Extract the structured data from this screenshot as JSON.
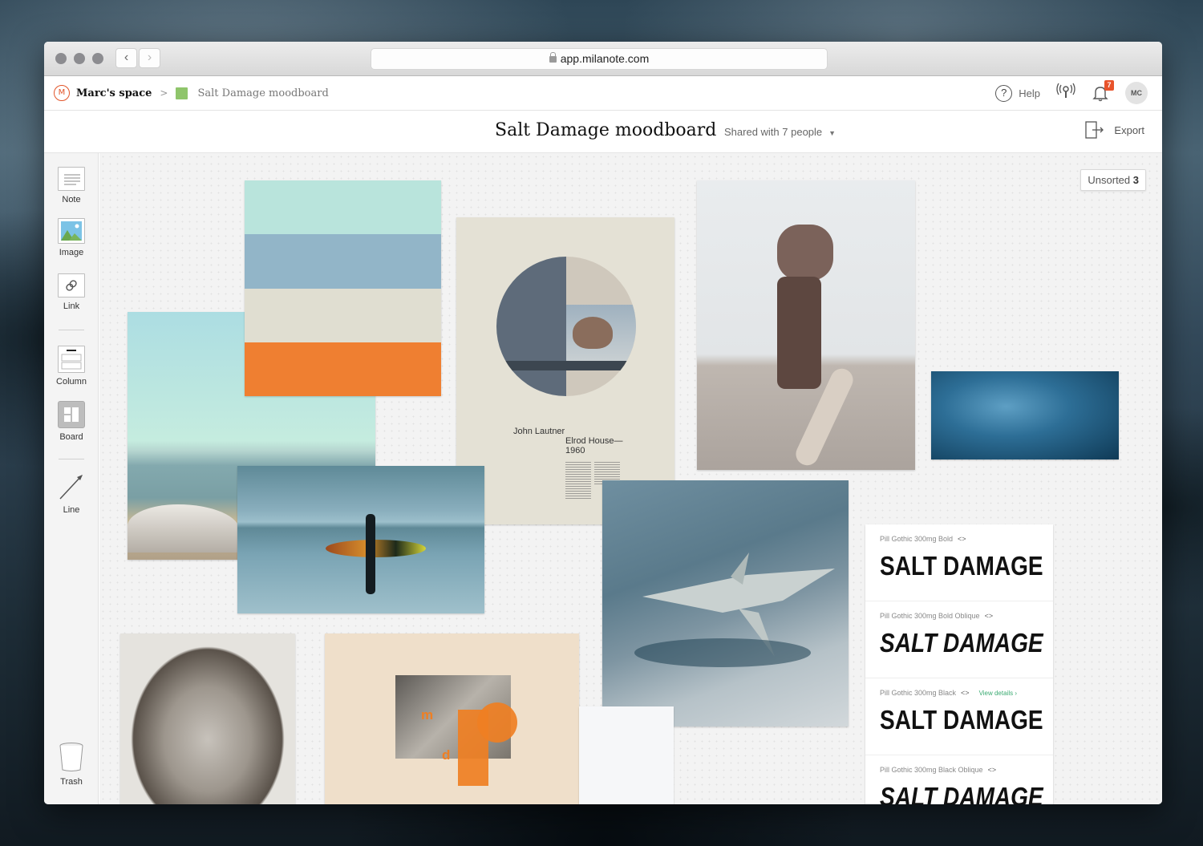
{
  "browser": {
    "url": "app.milanote.com",
    "back_icon": "chevron-left-icon",
    "forward_icon": "chevron-right-icon"
  },
  "header": {
    "logo_initials": "M",
    "breadcrumb": {
      "space": "Marc's space",
      "separator": ">",
      "board": "Salt Damage moodboard",
      "board_color": "#8fc56b"
    },
    "help_label": "Help",
    "notifications_count": "7",
    "avatar_initials": "MC",
    "accent_color": "#e8532b"
  },
  "titlebar": {
    "title": "Salt Damage moodboard",
    "shared": "Shared with 7 people",
    "export_label": "Export"
  },
  "sidebar": {
    "tools": [
      {
        "label": "Note",
        "icon": "note-icon"
      },
      {
        "label": "Image",
        "icon": "image-icon"
      },
      {
        "label": "Link",
        "icon": "link-icon"
      },
      {
        "label": "Column",
        "icon": "column-icon"
      },
      {
        "label": "Board",
        "icon": "board-icon"
      },
      {
        "label": "Line",
        "icon": "line-icon"
      }
    ],
    "trash_label": "Trash"
  },
  "canvas": {
    "unsorted_label": "Unsorted",
    "unsorted_count": "3",
    "palette": [
      "#b9e4dc",
      "#92b5c8",
      "#e0ded1",
      "#ef7f31"
    ],
    "poster": {
      "author": "John Lautner",
      "work_line1": "Elrod House—",
      "work_line2": "1960"
    },
    "collage": {
      "letter1": "m",
      "letter2": "d"
    },
    "type_specimens": [
      {
        "name": "Pill Gothic 300mg Bold",
        "sample": "SALT DAMAGE",
        "oblique": false,
        "link": ""
      },
      {
        "name": "Pill Gothic 300mg Bold Oblique",
        "sample": "SALT DAMAGE",
        "oblique": true,
        "link": ""
      },
      {
        "name": "Pill Gothic 300mg Black",
        "sample": "SALT DAMAGE",
        "oblique": false,
        "link": "View details ›"
      },
      {
        "name": "Pill Gothic 300mg Black Oblique",
        "sample": "SALT DAMAGE",
        "oblique": true,
        "link": ""
      }
    ],
    "code_glyph": "<>"
  }
}
